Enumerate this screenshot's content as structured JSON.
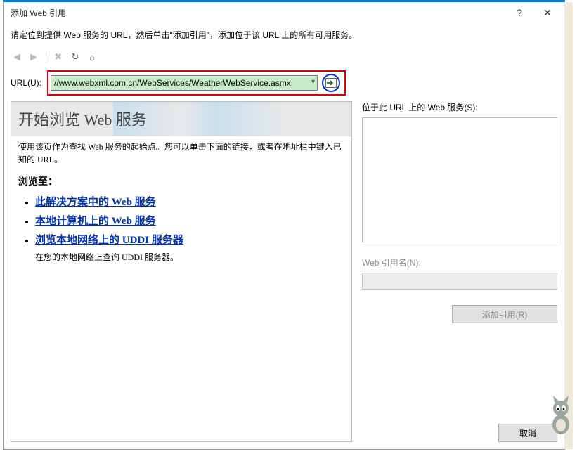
{
  "title": "添加 Web 引用",
  "instruction": "请定位到提供 Web 服务的 URL，然后单击\"添加引用\"，添加位于该 URL 上的所有可用服务。",
  "url": {
    "label": "URL(U):",
    "value": "//www.webxml.com.cn/WebServices/WeatherWebService.asmx"
  },
  "browse": {
    "heading": "开始浏览 Web 服务",
    "intro": "使用该页作为查找 Web 服务的起始点。您可以单击下面的链接，或者在地址栏中键入已知的 URL。",
    "browse_to": "浏览至：",
    "links": [
      {
        "label": "此解决方案中的 Web 服务",
        "sub": ""
      },
      {
        "label": "本地计算机上的 Web 服务",
        "sub": ""
      },
      {
        "label": "浏览本地网络上的 UDDI 服务器",
        "sub": "在您的本地网络上查询 UDDI 服务器。"
      }
    ]
  },
  "right": {
    "services_label": "位于此 URL 上的 Web 服务(S):",
    "refname_label": "Web 引用名(N):",
    "add_button": "添加引用(R)",
    "cancel_button": "取消"
  }
}
